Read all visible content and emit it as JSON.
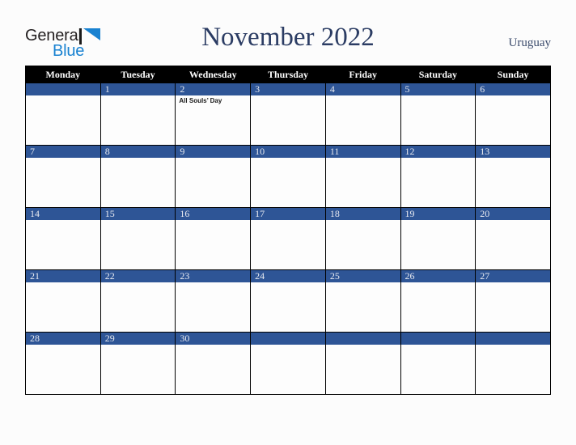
{
  "branding": {
    "logo_text_primary": "General",
    "logo_text_secondary": "Blue",
    "logo_mark_icon": "triangle-flag-icon",
    "color_primary_text": "#231f20",
    "color_secondary_text": "#1982d1"
  },
  "header": {
    "title": "November 2022",
    "country": "Uruguay",
    "title_color": "#2b3c63"
  },
  "calendar": {
    "month": "November",
    "year": "2022",
    "weekday_headers": [
      "Monday",
      "Tuesday",
      "Wednesday",
      "Thursday",
      "Friday",
      "Saturday",
      "Sunday"
    ],
    "header_bg_color": "#000000",
    "daynum_bg_color": "#2e5596",
    "daynum_text_color": "#e8eaf0",
    "cell_bg_color": "#fdfdfd",
    "border_color": "#000000",
    "weeks": [
      [
        {
          "day": "",
          "events": []
        },
        {
          "day": "1",
          "events": []
        },
        {
          "day": "2",
          "events": [
            "All Souls’ Day"
          ]
        },
        {
          "day": "3",
          "events": []
        },
        {
          "day": "4",
          "events": []
        },
        {
          "day": "5",
          "events": []
        },
        {
          "day": "6",
          "events": []
        }
      ],
      [
        {
          "day": "7",
          "events": []
        },
        {
          "day": "8",
          "events": []
        },
        {
          "day": "9",
          "events": []
        },
        {
          "day": "10",
          "events": []
        },
        {
          "day": "11",
          "events": []
        },
        {
          "day": "12",
          "events": []
        },
        {
          "day": "13",
          "events": []
        }
      ],
      [
        {
          "day": "14",
          "events": []
        },
        {
          "day": "15",
          "events": []
        },
        {
          "day": "16",
          "events": []
        },
        {
          "day": "17",
          "events": []
        },
        {
          "day": "18",
          "events": []
        },
        {
          "day": "19",
          "events": []
        },
        {
          "day": "20",
          "events": []
        }
      ],
      [
        {
          "day": "21",
          "events": []
        },
        {
          "day": "22",
          "events": []
        },
        {
          "day": "23",
          "events": []
        },
        {
          "day": "24",
          "events": []
        },
        {
          "day": "25",
          "events": []
        },
        {
          "day": "26",
          "events": []
        },
        {
          "day": "27",
          "events": []
        }
      ],
      [
        {
          "day": "28",
          "events": []
        },
        {
          "day": "29",
          "events": []
        },
        {
          "day": "30",
          "events": []
        },
        {
          "day": "",
          "events": []
        },
        {
          "day": "",
          "events": []
        },
        {
          "day": "",
          "events": []
        },
        {
          "day": "",
          "events": []
        }
      ]
    ]
  }
}
